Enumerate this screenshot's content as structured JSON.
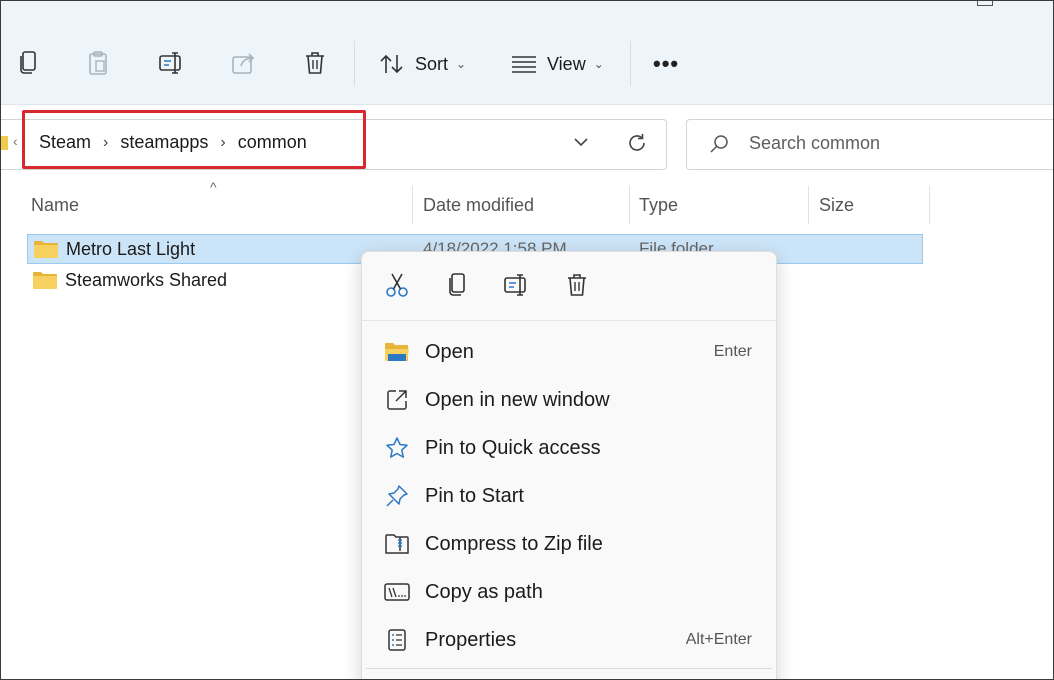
{
  "toolbar": {
    "sort_label": "Sort",
    "view_label": "View",
    "more_label": "•••"
  },
  "address": {
    "crumbs": [
      "Steam",
      "steamapps",
      "common"
    ]
  },
  "search": {
    "placeholder": "Search common"
  },
  "columns": {
    "name": "Name",
    "date": "Date modified",
    "type": "Type",
    "size": "Size"
  },
  "files": [
    {
      "name": "Metro Last Light",
      "date": "4/18/2022 1:58 PM",
      "type": "File folder"
    },
    {
      "name": "Steamworks Shared",
      "date": "",
      "type": ""
    }
  ],
  "context_menu": {
    "items": [
      {
        "label": "Open",
        "shortcut": "Enter",
        "icon": "folder-open-icon"
      },
      {
        "label": "Open in new window",
        "shortcut": "",
        "icon": "open-new-window-icon"
      },
      {
        "label": "Pin to Quick access",
        "shortcut": "",
        "icon": "star-icon"
      },
      {
        "label": "Pin to Start",
        "shortcut": "",
        "icon": "pin-icon"
      },
      {
        "label": "Compress to Zip file",
        "shortcut": "",
        "icon": "zip-icon"
      },
      {
        "label": "Copy as path",
        "shortcut": "",
        "icon": "copy-path-icon"
      },
      {
        "label": "Properties",
        "shortcut": "Alt+Enter",
        "icon": "properties-icon"
      }
    ]
  },
  "colors": {
    "highlight_box": "#d7282f",
    "selection": "#cce4f7",
    "accent": "#2b78c5",
    "folder": "#f2c94c"
  }
}
